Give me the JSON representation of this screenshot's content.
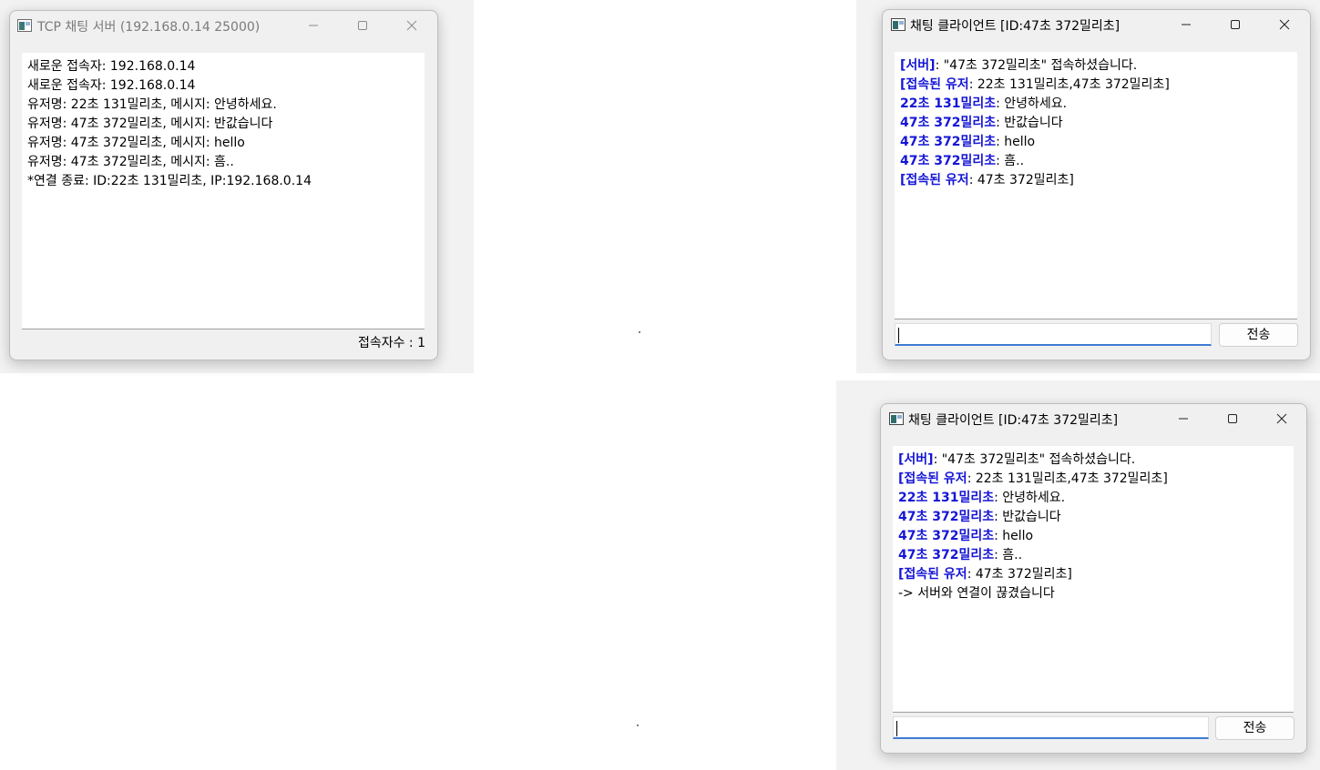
{
  "server_window": {
    "title": "TCP 채팅 서버 (192.168.0.14 25000)",
    "log_lines": [
      "새로운 접속자: 192.168.0.14",
      "새로운 접속자: 192.168.0.14",
      "유저명: 22초 131밀리초, 메시지: 안녕하세요.",
      "유저명: 47초 372밀리초, 메시지: 반값습니다",
      "유저명: 47초 372밀리초, 메시지: hello",
      "유저명: 47초 372밀리초, 메시지: 흠..",
      "*연결 종료: ID:22초 131밀리초, IP:192.168.0.14"
    ],
    "status": "접속자수 : 1"
  },
  "client_window_1": {
    "title": "채팅 클라이언트 [ID:47초 372밀리초]",
    "messages": [
      {
        "tag": "[서버]",
        "text": ": \"47초 372밀리초\" 접속하셨습니다."
      },
      {
        "tag": "[접속된 유저",
        "text": ": 22초 131밀리초,47초 372밀리초]"
      },
      {
        "tag": "22초 131밀리초",
        "text": ": 안녕하세요."
      },
      {
        "tag": "47초 372밀리초",
        "text": ": 반값습니다"
      },
      {
        "tag": "47초 372밀리초",
        "text": ": hello"
      },
      {
        "tag": "47초 372밀리초",
        "text": ": 흠.."
      },
      {
        "tag": "[접속된 유저",
        "text": ": 47초 372밀리초]"
      }
    ],
    "input_value": "",
    "send_label": "전송"
  },
  "client_window_2": {
    "title": "채팅 클라이언트 [ID:47초 372밀리초]",
    "messages": [
      {
        "tag": "[서버]",
        "text": ": \"47초 372밀리초\" 접속하셨습니다."
      },
      {
        "tag": "[접속된 유저",
        "text": ": 22초 131밀리초,47초 372밀리초]"
      },
      {
        "tag": "22초 131밀리초",
        "text": ": 안녕하세요."
      },
      {
        "tag": "47초 372밀리초",
        "text": ": 반값습니다"
      },
      {
        "tag": "47초 372밀리초",
        "text": ": hello"
      },
      {
        "tag": "47초 372밀리초",
        "text": ": 흠.."
      },
      {
        "tag": "[접속된 유저",
        "text": ": 47초 372밀리초]"
      },
      {
        "tag": "",
        "text": "-> 서버와 연결이 끊겼습니다"
      }
    ],
    "input_value": "",
    "send_label": "전송"
  },
  "colors": {
    "tag_text": "#1515d6",
    "input_focus_underline": "#3f7bd2",
    "inactive_title": "#7a7a7a"
  },
  "icons": [
    "app-icon",
    "minimize-icon",
    "maximize-icon",
    "close-icon"
  ]
}
